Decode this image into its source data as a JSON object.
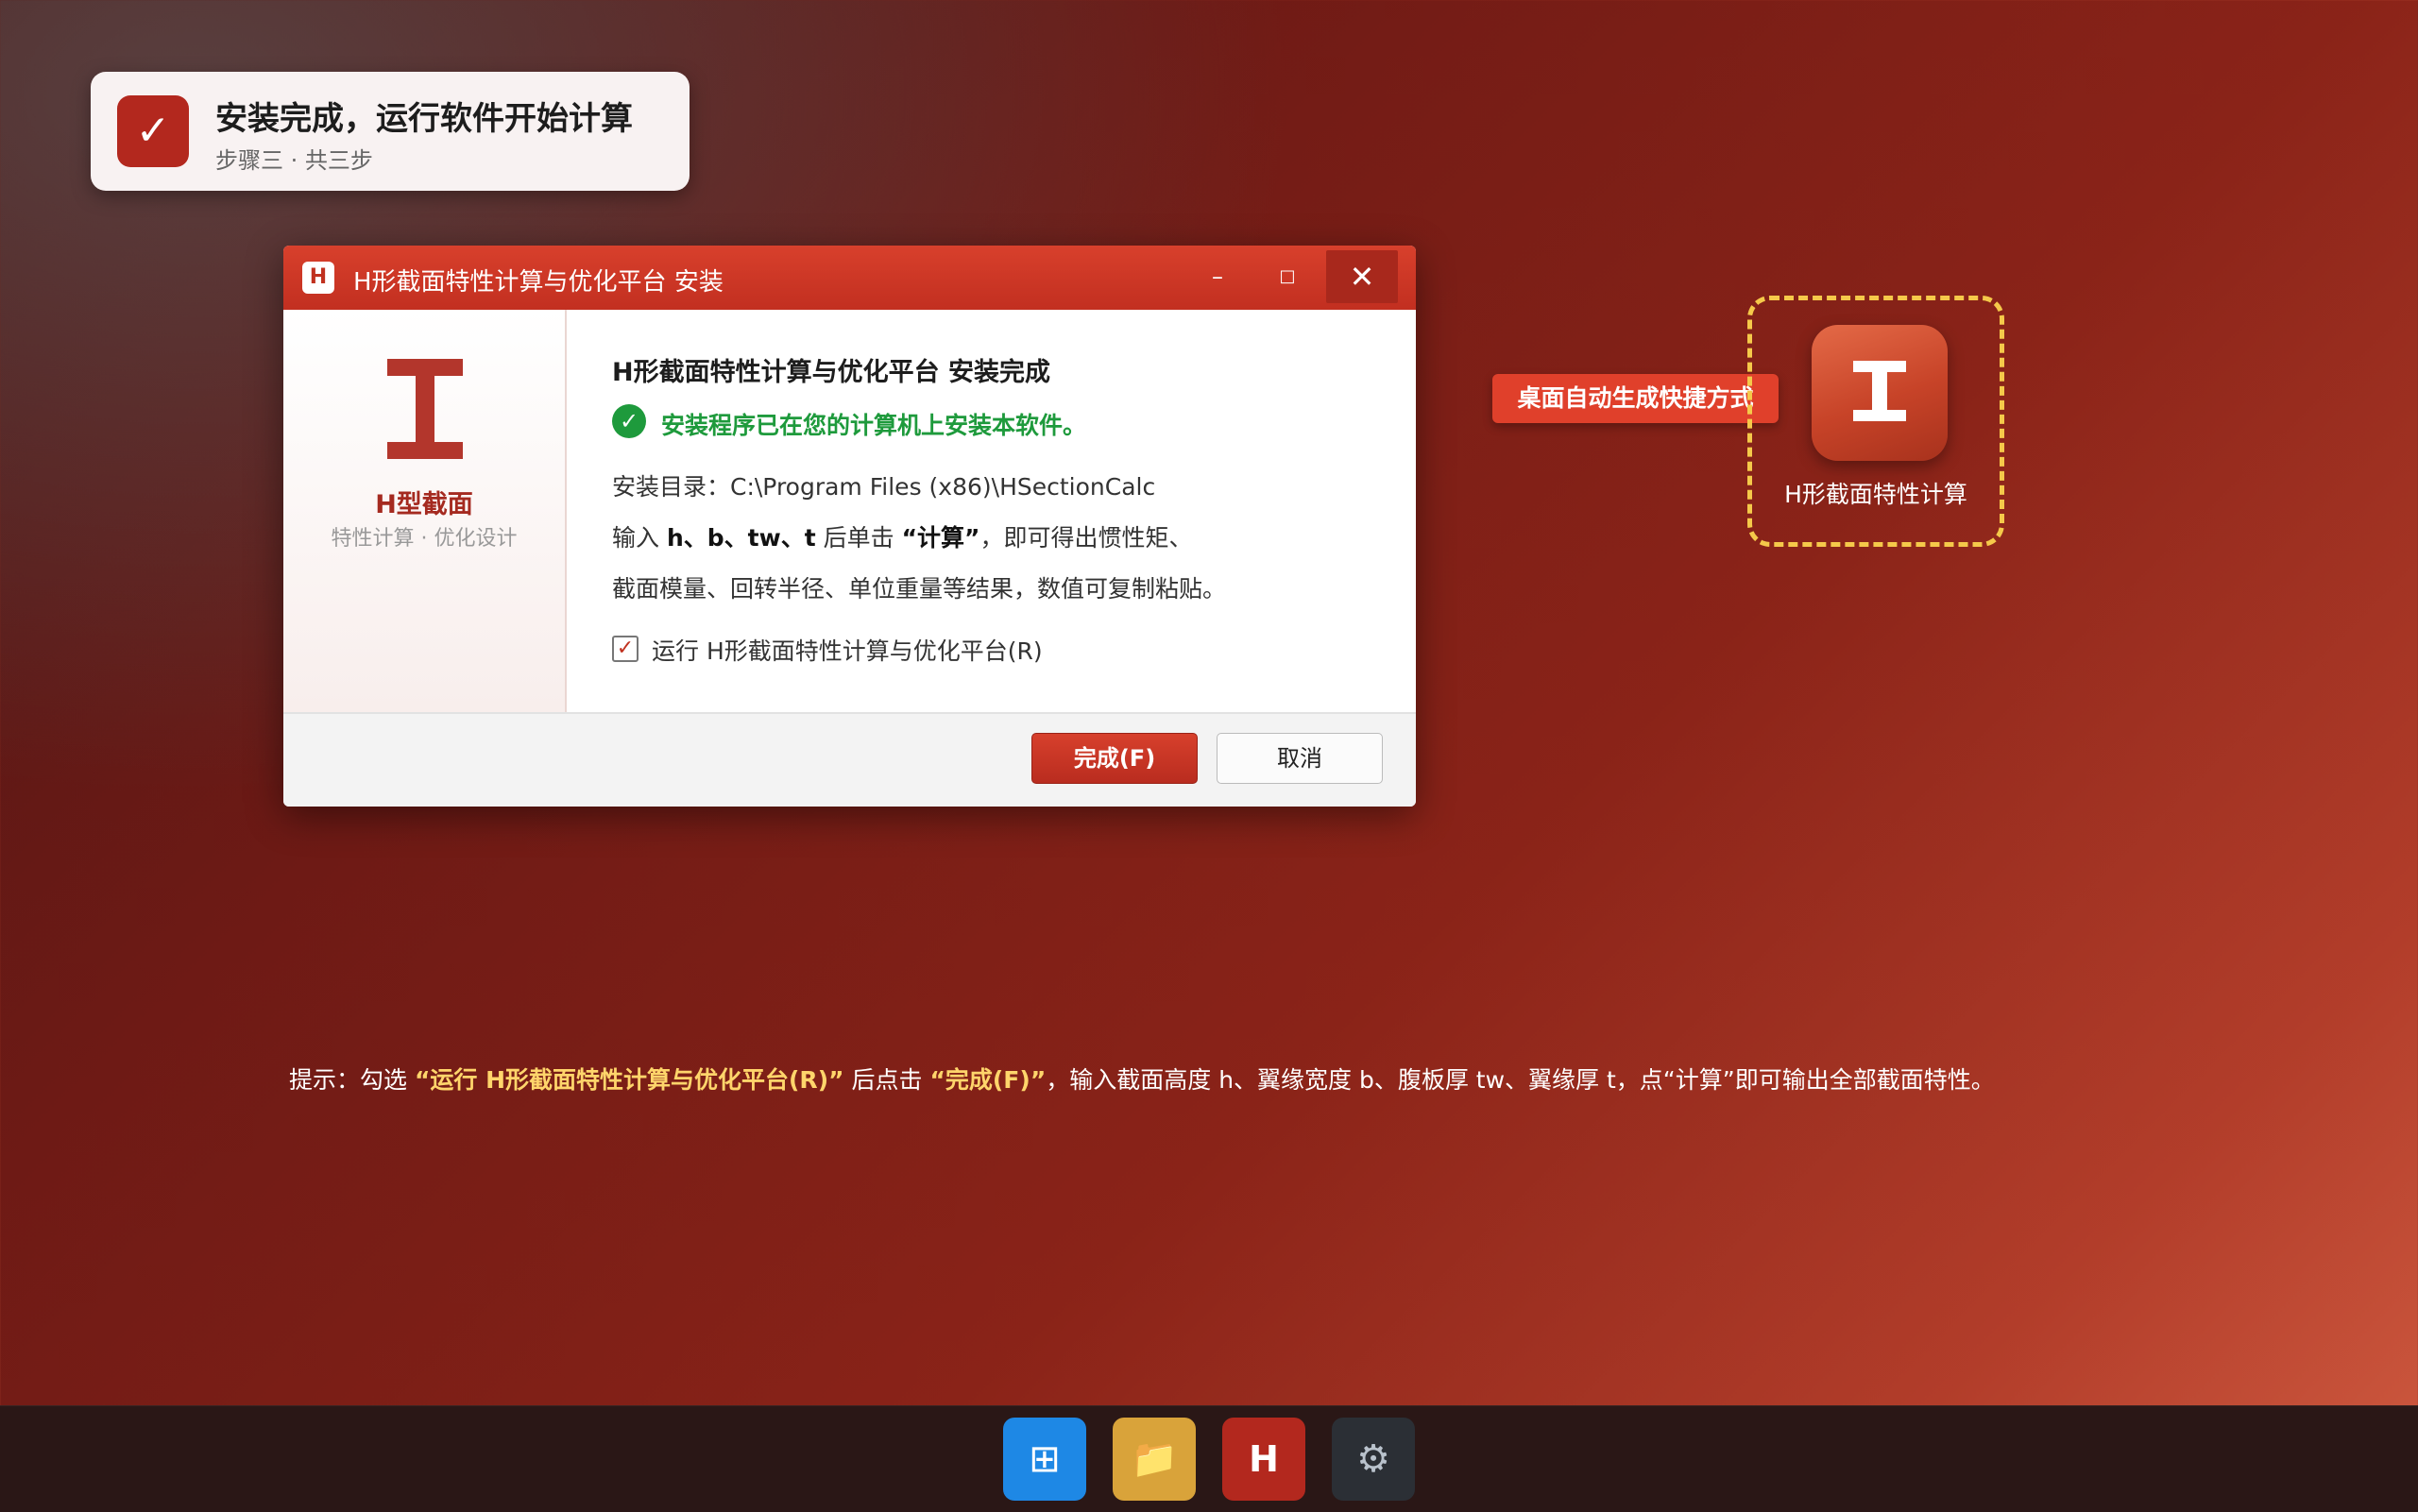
{
  "toast": {
    "badge": "✓",
    "title": "安装完成，运行软件开始计算",
    "subtitle": "步骤三 · 共三步"
  },
  "window": {
    "app_icon_letter": "H",
    "title": "H形截面特性计算与优化平台 安装",
    "minimize": "–",
    "maximize": "□",
    "close": "✕"
  },
  "sidebar": {
    "name": "H型截面",
    "subtitle": "特性计算 · 优化设计"
  },
  "content": {
    "heading": "H形截面特性计算与优化平台 安装完成",
    "success_icon": "✓",
    "success_text": "安装程序已在您的计算机上安装本软件。",
    "install_dir": "安装目录：C:\\Program Files (x86)\\HSectionCalc",
    "desc1_pre": "输入 ",
    "desc1_params": "h、b、tw、t",
    "desc1_mid": " 后单击 ",
    "desc1_calc": "“计算”",
    "desc1_post": "，即可得出惯性矩、",
    "desc2": "截面模量、回转半径、单位重量等结果，数值可复制粘贴。",
    "run_checked": "✓",
    "run_label": "运行 H形截面特性计算与优化平台(R)"
  },
  "buttons": {
    "finish": "完成(F)",
    "cancel": "取消"
  },
  "desktop": {
    "callout": "桌面自动生成快捷方式",
    "shortcut_label": "H形截面特性计算"
  },
  "hint": {
    "pre": "提示：勾选 ",
    "opt": "“运行 H形截面特性计算与优化平台(R)”",
    "mid": " 后点击 ",
    "finish": "“完成(F)”",
    "post": "，输入截面高度 h、翼缘宽度 b、腹板厚 tw、翼缘厚 t，点“计算”即可输出全部截面特性。"
  },
  "taskbar": {
    "start": "⊞",
    "folder": "📁",
    "app": "H",
    "settings": "⚙"
  }
}
